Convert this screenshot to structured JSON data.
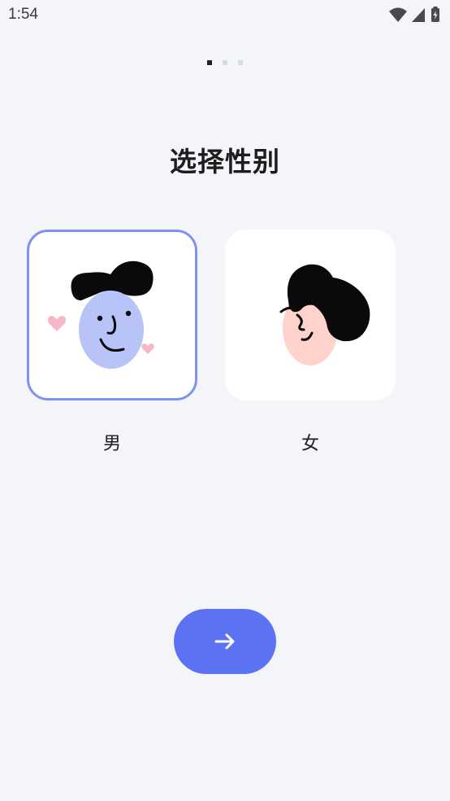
{
  "status_bar": {
    "time": "1:54",
    "icons": [
      "wifi-icon",
      "cellular-signal-icon",
      "battery-charging-icon"
    ]
  },
  "pager": {
    "total_pages": 3,
    "active_index": 0,
    "active_color": "#222222",
    "inactive_color": "#d9dbe3"
  },
  "title": "选择性别",
  "options": [
    {
      "label": "男",
      "icon": "male-avatar-icon",
      "selected": true,
      "accent_color": "#8091f2",
      "face_color": "#b8c3f7"
    },
    {
      "label": "女",
      "icon": "female-avatar-icon",
      "selected": false,
      "face_color": "#ffd2cc"
    }
  ],
  "next_button": {
    "icon": "arrow-right-icon",
    "color": "#5b73f2"
  }
}
